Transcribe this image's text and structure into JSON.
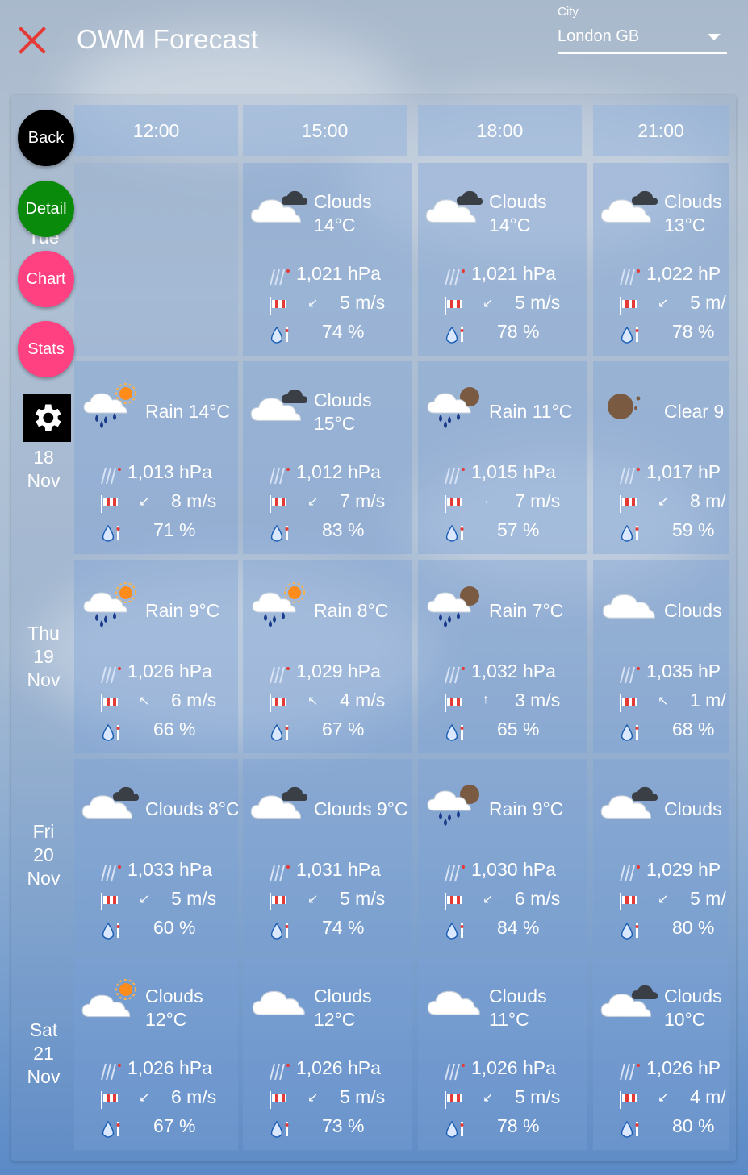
{
  "app": {
    "title": "OWM Forecast"
  },
  "city": {
    "label": "City",
    "value": "London GB"
  },
  "actions": {
    "back": "Back",
    "detail": "Detail",
    "chart": "Chart",
    "stats": "Stats"
  },
  "hours": [
    "12:00",
    "15:00",
    "18:00",
    "21:00"
  ],
  "days": [
    {
      "dow": "Tue",
      "day": "",
      "month": ""
    },
    {
      "dow": "",
      "day": "18",
      "month": "Nov"
    },
    {
      "dow": "Thu",
      "day": "19",
      "month": "Nov"
    },
    {
      "dow": "Fri",
      "day": "20",
      "month": "Nov"
    },
    {
      "dow": "Sat",
      "day": "21",
      "month": "Nov"
    }
  ],
  "colors": {
    "close": "#e53935",
    "back": "#000000",
    "detail": "#0a8a0a",
    "chart": "#ff4081",
    "stats": "#ff4081",
    "sun": "#ff8c1a",
    "rain": "#1a3a8a",
    "moon": "#7a5a40"
  },
  "grid": [
    [
      null,
      {
        "icon": "clouds-night",
        "desc1": "Clouds",
        "desc2": "14°C",
        "pressure": "1,021 hPa",
        "wind_dir": "sw",
        "wind": "5 m/s",
        "humidity": "74 %"
      },
      {
        "icon": "clouds-night",
        "desc1": "Clouds",
        "desc2": "14°C",
        "pressure": "1,021 hPa",
        "wind_dir": "sw",
        "wind": "5 m/s",
        "humidity": "78 %"
      },
      {
        "icon": "clouds-night",
        "desc1": "Clouds",
        "desc2": "13°C",
        "pressure": "1,022 hP",
        "wind_dir": "sw",
        "wind": "5 m/",
        "humidity": "78 %"
      }
    ],
    [
      {
        "icon": "rain-day",
        "desc1": "Rain 14°C",
        "desc2": "",
        "pressure": "1,013 hPa",
        "wind_dir": "sw",
        "wind": "8 m/s",
        "humidity": "71 %"
      },
      {
        "icon": "clouds-night",
        "desc1": "Clouds",
        "desc2": "15°C",
        "pressure": "1,012 hPa",
        "wind_dir": "sw",
        "wind": "7 m/s",
        "humidity": "83 %"
      },
      {
        "icon": "rain-night",
        "desc1": "Rain 11°C",
        "desc2": "",
        "pressure": "1,015 hPa",
        "wind_dir": "w",
        "wind": "7 m/s",
        "humidity": "57 %"
      },
      {
        "icon": "clear-night",
        "desc1": "Clear 9",
        "desc2": "",
        "pressure": "1,017 hP",
        "wind_dir": "sw",
        "wind": "8 m/",
        "humidity": "59 %"
      }
    ],
    [
      {
        "icon": "rain-day",
        "desc1": "Rain 9°C",
        "desc2": "",
        "pressure": "1,026 hPa",
        "wind_dir": "nw",
        "wind": "6 m/s",
        "humidity": "66 %"
      },
      {
        "icon": "rain-day",
        "desc1": "Rain 8°C",
        "desc2": "",
        "pressure": "1,029 hPa",
        "wind_dir": "nw",
        "wind": "4 m/s",
        "humidity": "67 %"
      },
      {
        "icon": "rain-night",
        "desc1": "Rain 7°C",
        "desc2": "",
        "pressure": "1,032 hPa",
        "wind_dir": "n",
        "wind": "3 m/s",
        "humidity": "65 %"
      },
      {
        "icon": "clouds",
        "desc1": "Clouds",
        "desc2": "",
        "pressure": "1,035 hP",
        "wind_dir": "nw",
        "wind": "1 m/",
        "humidity": "68 %"
      }
    ],
    [
      {
        "icon": "clouds-night",
        "desc1": "Clouds 8°C",
        "desc2": "",
        "pressure": "1,033 hPa",
        "wind_dir": "sw",
        "wind": "5 m/s",
        "humidity": "60 %"
      },
      {
        "icon": "clouds-night",
        "desc1": "Clouds 9°C",
        "desc2": "",
        "pressure": "1,031 hPa",
        "wind_dir": "sw",
        "wind": "5 m/s",
        "humidity": "74 %"
      },
      {
        "icon": "rain-night",
        "desc1": "Rain 9°C",
        "desc2": "",
        "pressure": "1,030 hPa",
        "wind_dir": "sw",
        "wind": "6 m/s",
        "humidity": "84 %"
      },
      {
        "icon": "clouds-night",
        "desc1": "Clouds",
        "desc2": "",
        "pressure": "1,029 hP",
        "wind_dir": "sw",
        "wind": "5 m/",
        "humidity": "80 %"
      }
    ],
    [
      {
        "icon": "clouds-day",
        "desc1": "Clouds",
        "desc2": "12°C",
        "pressure": "1,026 hPa",
        "wind_dir": "sw",
        "wind": "6 m/s",
        "humidity": "67 %"
      },
      {
        "icon": "clouds",
        "desc1": "Clouds",
        "desc2": "12°C",
        "pressure": "1,026 hPa",
        "wind_dir": "sw",
        "wind": "5 m/s",
        "humidity": "73 %"
      },
      {
        "icon": "clouds",
        "desc1": "Clouds",
        "desc2": "11°C",
        "pressure": "1,026 hPa",
        "wind_dir": "sw",
        "wind": "5 m/s",
        "humidity": "78 %"
      },
      {
        "icon": "clouds-night",
        "desc1": "Clouds",
        "desc2": "10°C",
        "pressure": "1,026 hP",
        "wind_dir": "sw",
        "wind": "4 m/",
        "humidity": "80 %"
      }
    ]
  ]
}
